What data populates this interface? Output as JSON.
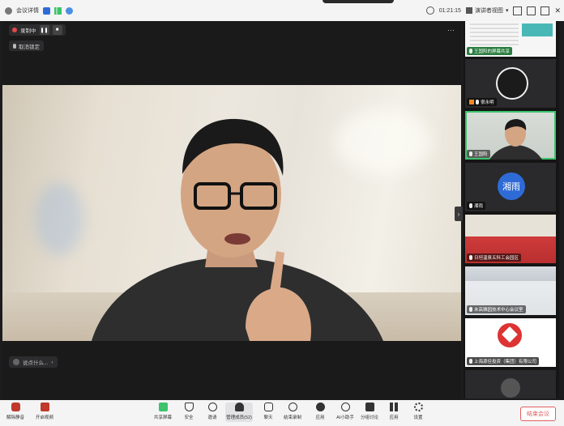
{
  "topbar": {
    "meeting_info": "会议详情",
    "timer": "01:21:15",
    "view_label": "演讲者视图",
    "icons": [
      "info-icon",
      "shield-icon",
      "signal-icon",
      "network-icon"
    ]
  },
  "recording": {
    "label": "录制中"
  },
  "main": {
    "cancel_speaker": "取消锁定",
    "say_placeholder": "说点什么..."
  },
  "participants": [
    {
      "name": "王国阳的屏幕共享",
      "kind": "screen"
    },
    {
      "name": "很永明",
      "kind": "avatar-photo",
      "host": true
    },
    {
      "name": "王国阳",
      "kind": "video",
      "active": true
    },
    {
      "name": "湘雨",
      "kind": "text-avatar",
      "avatar_text": "湘雨"
    },
    {
      "name": "日坦温泉五科工会园区",
      "kind": "room-red"
    },
    {
      "name": "未高雅园技术中心会议室",
      "kind": "room-blue"
    },
    {
      "name": "上海源佳投资（集团）有限公司",
      "kind": "logo"
    },
    {
      "name": "",
      "kind": "partial"
    }
  ],
  "bottombar": {
    "left": [
      {
        "label": "解除静音",
        "icon": "mic-muted-icon"
      },
      {
        "label": "开启视频",
        "icon": "camera-off-icon"
      }
    ],
    "center": [
      {
        "label": "共享屏幕",
        "icon": "share-screen-icon"
      },
      {
        "label": "安全",
        "icon": "security-icon"
      },
      {
        "label": "邀请",
        "icon": "invite-icon"
      },
      {
        "label": "管理成员(52)",
        "icon": "members-icon"
      },
      {
        "label": "聊天",
        "icon": "chat-icon"
      },
      {
        "label": "结束录制",
        "icon": "record-icon"
      },
      {
        "label": "应用",
        "icon": "apps-icon"
      },
      {
        "label": "AI小助手",
        "icon": "ai-assistant-icon"
      },
      {
        "label": "分组讨论",
        "icon": "breakout-icon"
      },
      {
        "label": "应用",
        "icon": "apps2-icon"
      },
      {
        "label": "设置",
        "icon": "settings-icon"
      }
    ],
    "leave": "结束会议"
  },
  "colors": {
    "accent": "#3cc36b",
    "danger": "#e26060",
    "host": "#f08a24"
  }
}
